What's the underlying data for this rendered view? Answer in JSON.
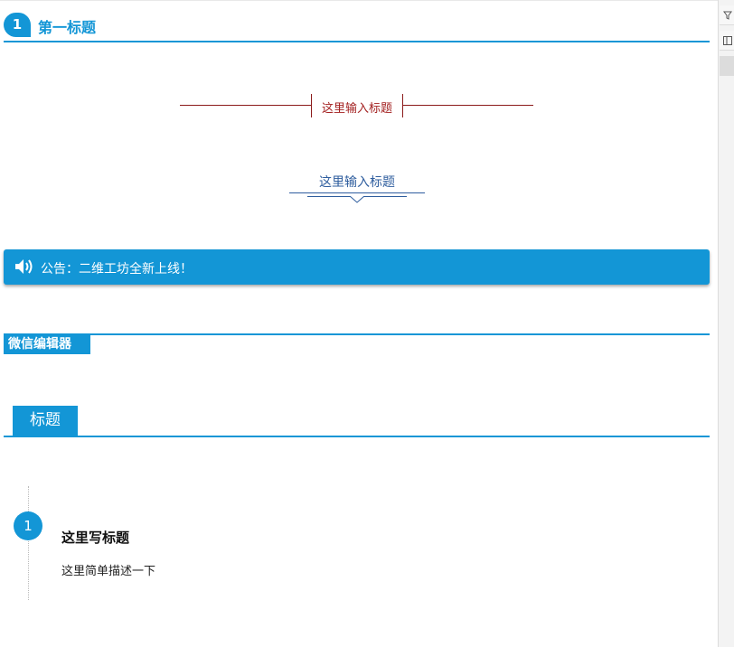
{
  "heading_1": {
    "number": "1",
    "text": "第一标题"
  },
  "red_title": {
    "text": "这里输入标题"
  },
  "blue_title": {
    "text": "这里输入标题"
  },
  "notice": {
    "text": "公告：二维工坊全新上线！",
    "icon": "speaker-icon"
  },
  "editor_tag": {
    "text": "微信编辑器"
  },
  "tab_title": {
    "text": "标题"
  },
  "timeline": {
    "number": "1",
    "title": "这里写标题",
    "description": "这里简单描述一下"
  },
  "colors": {
    "accent": "#1396d6",
    "red": "#8b1a1a",
    "navy": "#2e5d9e"
  }
}
